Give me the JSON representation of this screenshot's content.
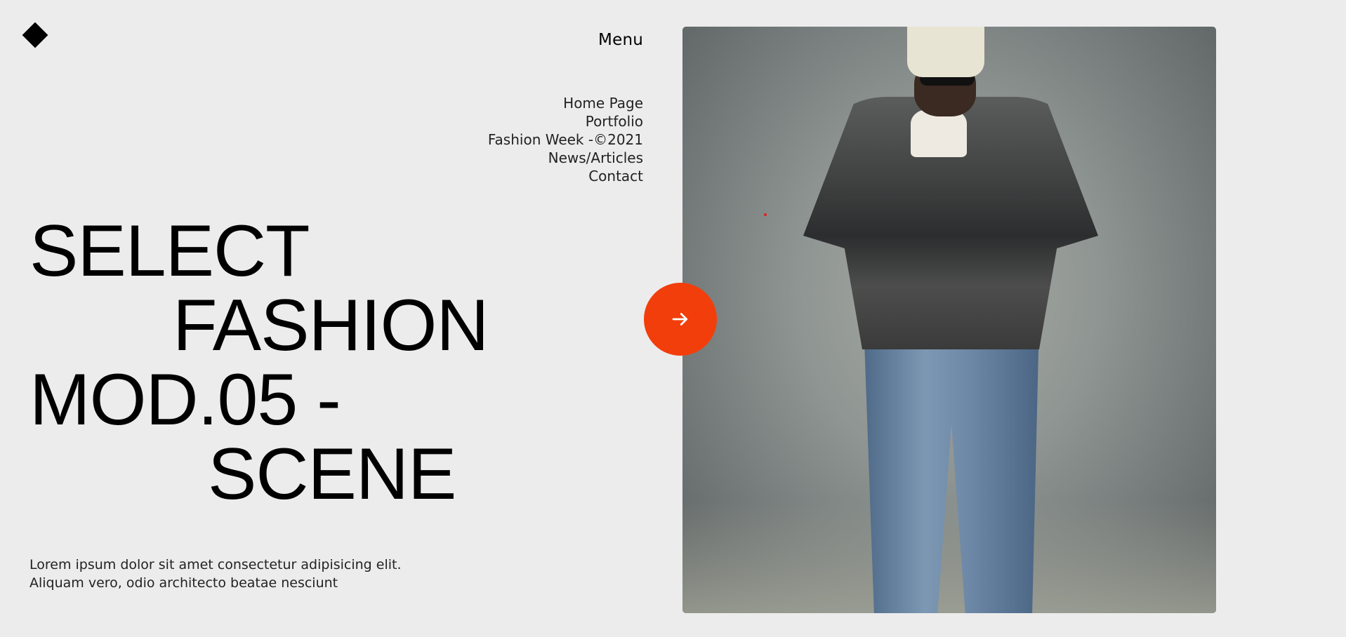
{
  "header": {
    "logo_icon": "diamond-icon",
    "menu_label": "Menu"
  },
  "nav": {
    "items": [
      {
        "label": "Home Page"
      },
      {
        "label": "Portfolio"
      },
      {
        "label": "Fashion Week -©2021"
      },
      {
        "label": "News/Articles"
      },
      {
        "label": "Contact"
      }
    ]
  },
  "hero": {
    "headline_lines": [
      "SELECT",
      "FASHION",
      "MOD.05 -",
      "SCENE"
    ],
    "description": "Lorem ipsum dolor sit amet consectetur adipisicing elit. Aliquam vero, odio architecto beatae nesciunt",
    "next_button_icon": "arrow-right-icon",
    "accent_color": "#f23e0b"
  },
  "media": {
    "photo_icon": "fashion-model-photo"
  }
}
